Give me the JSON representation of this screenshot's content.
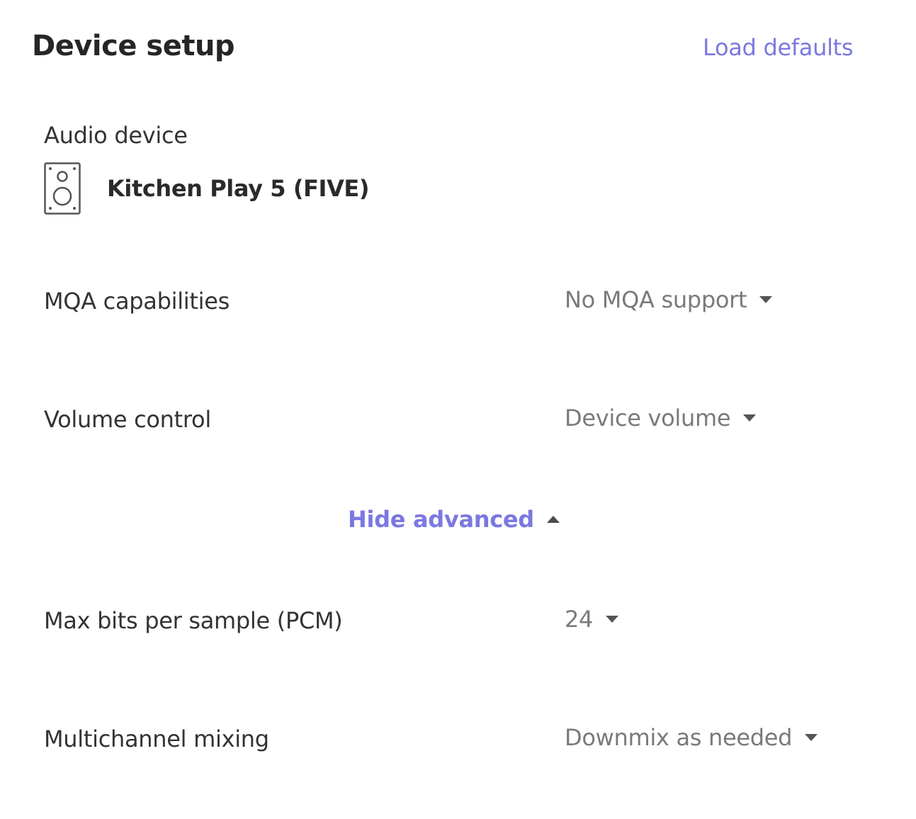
{
  "header": {
    "title": "Device setup",
    "load_defaults_label": "Load defaults"
  },
  "audio_device": {
    "label": "Audio device",
    "icon": "speaker-icon",
    "name": "Kitchen Play 5 (FIVE)"
  },
  "settings": {
    "mqa": {
      "label": "MQA capabilities",
      "value": "No MQA support"
    },
    "volume": {
      "label": "Volume control",
      "value": "Device volume"
    },
    "advanced_toggle": "Hide advanced",
    "max_bits": {
      "label": "Max bits per sample (PCM)",
      "value": "24"
    },
    "multichannel": {
      "label": "Multichannel mixing",
      "value": "Downmix as needed"
    }
  },
  "colors": {
    "accent": "#7b78e0",
    "value_text": "#7a7a7a",
    "label_text": "#333333"
  }
}
